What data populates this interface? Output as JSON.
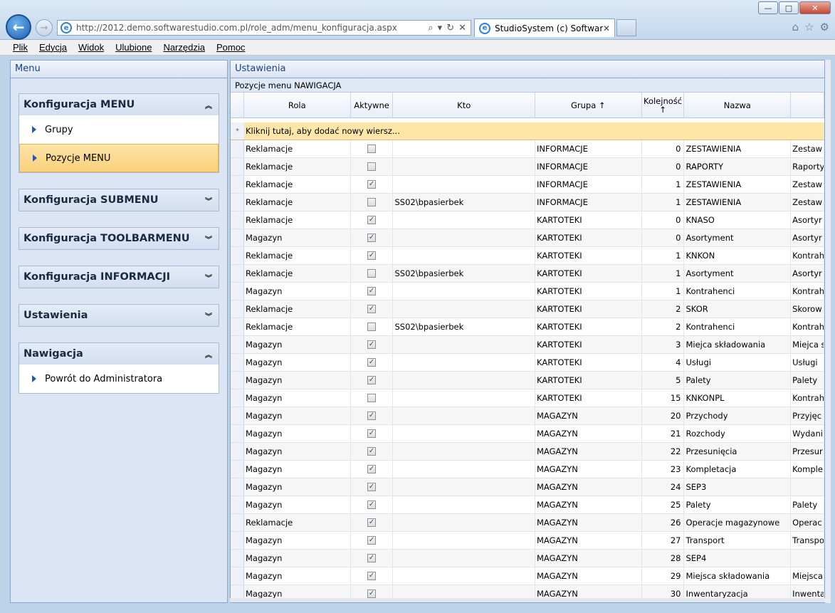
{
  "browser": {
    "url": "http://2012.demo.softwarestudio.com.pl/role_adm/menu_konfiguracja.aspx",
    "tab_title": "StudioSystem (c) SoftwareS...",
    "menu": [
      "Plik",
      "Edycja",
      "Widok",
      "Ulubione",
      "Narzędzia",
      "Pomoc"
    ]
  },
  "left_panel": {
    "title": "Menu",
    "groups": [
      {
        "label": "Konfiguracja MENU",
        "expanded": true,
        "items": [
          "Grupy",
          "Pozycje MENU"
        ],
        "selected": "Pozycje MENU"
      },
      {
        "label": "Konfiguracja SUBMENU",
        "expanded": false,
        "items": []
      },
      {
        "label": "Konfiguracja TOOLBARMENU",
        "expanded": false,
        "items": []
      },
      {
        "label": "Konfiguracja INFORMACJI",
        "expanded": false,
        "items": []
      },
      {
        "label": "Ustawienia",
        "expanded": false,
        "items": []
      },
      {
        "label": "Nawigacja",
        "expanded": true,
        "items": [
          "Powrót do Administratora"
        ]
      }
    ]
  },
  "right_panel": {
    "title": "Ustawienia",
    "subtitle": "Pozycje menu NAWIGACJA",
    "columns": [
      "Rola",
      "Aktywne",
      "Kto",
      "Grupa ↑",
      "Kolejność ↑",
      "Nazwa",
      ""
    ],
    "add_row_text": "Kliknij tutaj, aby dodać nowy wiersz...",
    "add_row_marker": "*",
    "rows": [
      [
        "Reklamacje",
        false,
        "",
        "INFORMACJE",
        "0",
        "ZESTAWIENIA",
        "Zestaw"
      ],
      [
        "Reklamacje",
        false,
        "",
        "INFORMACJE",
        "0",
        "RAPORTY",
        "Raporty"
      ],
      [
        "Reklamacje",
        true,
        "",
        "INFORMACJE",
        "1",
        "ZESTAWIENIA",
        "Zestaw"
      ],
      [
        "Reklamacje",
        false,
        "SS02\\bpasierbek",
        "INFORMACJE",
        "1",
        "ZESTAWIENIA",
        "Zestaw"
      ],
      [
        "Reklamacje",
        true,
        "",
        "KARTOTEKI",
        "0",
        "KNASO",
        "Asortyr"
      ],
      [
        "Magazyn",
        true,
        "",
        "KARTOTEKI",
        "0",
        "Asortyment",
        "Asortyr"
      ],
      [
        "Reklamacje",
        true,
        "",
        "KARTOTEKI",
        "1",
        "KNKON",
        "Kontrah"
      ],
      [
        "Reklamacje",
        false,
        "SS02\\bpasierbek",
        "KARTOTEKI",
        "1",
        "Asortyment",
        "Asortyr"
      ],
      [
        "Magazyn",
        true,
        "",
        "KARTOTEKI",
        "1",
        "Kontrahenci",
        "Kontrah"
      ],
      [
        "Reklamacje",
        true,
        "",
        "KARTOTEKI",
        "2",
        "SKOR",
        "Skorow"
      ],
      [
        "Reklamacje",
        false,
        "SS02\\bpasierbek",
        "KARTOTEKI",
        "2",
        "Kontrahenci",
        "Kontrah"
      ],
      [
        "Magazyn",
        true,
        "",
        "KARTOTEKI",
        "3",
        "Miejca składowania",
        "Miejca s"
      ],
      [
        "Magazyn",
        true,
        "",
        "KARTOTEKI",
        "4",
        "Usługi",
        "Usługi"
      ],
      [
        "Magazyn",
        true,
        "",
        "KARTOTEKI",
        "5",
        "Palety",
        "Palety"
      ],
      [
        "Magazyn",
        false,
        "",
        "KARTOTEKI",
        "15",
        "KNKONPL",
        "Kontrah"
      ],
      [
        "Magazyn",
        true,
        "",
        "MAGAZYN",
        "20",
        "Przychody",
        "Przyjęc"
      ],
      [
        "Magazyn",
        true,
        "",
        "MAGAZYN",
        "21",
        "Rozchody",
        "Wydani"
      ],
      [
        "Magazyn",
        true,
        "",
        "MAGAZYN",
        "22",
        "Przesunięcia",
        "Przesur"
      ],
      [
        "Magazyn",
        true,
        "",
        "MAGAZYN",
        "23",
        "Kompletacja",
        "Komple"
      ],
      [
        "Magazyn",
        true,
        "",
        "MAGAZYN",
        "24",
        "SEP3",
        ""
      ],
      [
        "Magazyn",
        true,
        "",
        "MAGAZYN",
        "25",
        "Palety",
        "Palety"
      ],
      [
        "Reklamacje",
        true,
        "",
        "MAGAZYN",
        "26",
        "Operacje magazynowe",
        "Operac"
      ],
      [
        "Magazyn",
        true,
        "",
        "MAGAZYN",
        "27",
        "Transport",
        "Transpo"
      ],
      [
        "Magazyn",
        true,
        "",
        "MAGAZYN",
        "28",
        "SEP4",
        ""
      ],
      [
        "Magazyn",
        true,
        "",
        "MAGAZYN",
        "29",
        "Miejsca składowania",
        "Miejsca"
      ],
      [
        "Magazyn",
        true,
        "",
        "MAGAZYN",
        "30",
        "Inwentaryzacja",
        "Inwenta"
      ]
    ]
  }
}
